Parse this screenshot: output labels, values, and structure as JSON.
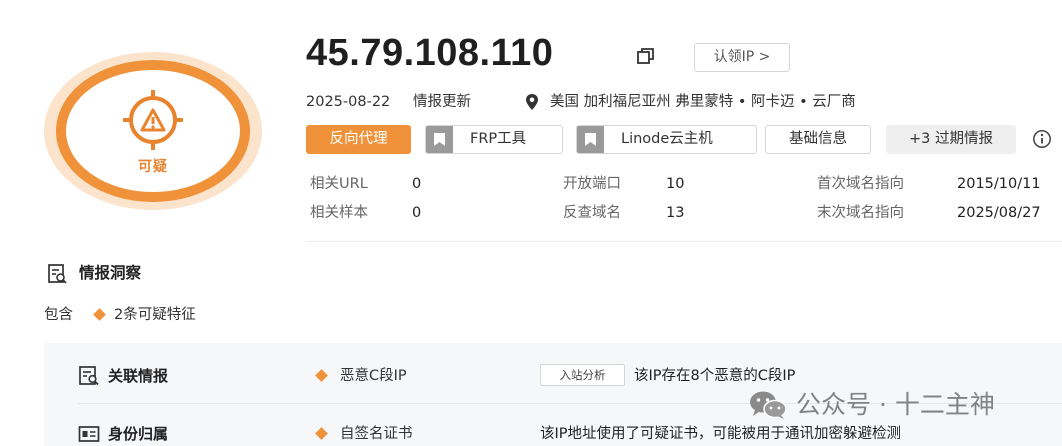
{
  "verdict": {
    "label": "可疑",
    "icon": "bug-warning-icon",
    "color": "#f0923a"
  },
  "header": {
    "ip": "45.79.108.110",
    "claim_button": "认领IP >",
    "update_date": "2025-08-22",
    "update_label": "情报更新",
    "location": "美国 加利福尼亚州 弗里蒙特 • 阿卡迈 • 云厂商"
  },
  "tags": [
    {
      "label": "反向代理"
    },
    {
      "label": "FRP工具"
    },
    {
      "label": "Linode云主机"
    },
    {
      "label": "基础信息"
    },
    {
      "label": "+3 过期情报"
    }
  ],
  "stats": {
    "related_url": {
      "key": "相关URL",
      "value": "0"
    },
    "related_samples": {
      "key": "相关样本",
      "value": "0"
    },
    "open_ports": {
      "key": "开放端口",
      "value": "10"
    },
    "reverse_domains": {
      "key": "反查域名",
      "value": "13"
    },
    "first_domain": {
      "key": "首次域名指向",
      "value": "2015/10/11"
    },
    "last_domain": {
      "key": "末次域名指向",
      "value": "2025/08/27"
    }
  },
  "insight": {
    "title": "情报洞察",
    "contains_label": "包含",
    "count_label": "2条可疑特征"
  },
  "rows": [
    {
      "category": "关联情报",
      "feature": "恶意C段IP",
      "chip": "入站分析",
      "description": "该IP存在8个恶意的C段IP"
    },
    {
      "category": "身份归属",
      "feature": "自签名证书",
      "chip": "",
      "description": "该IP地址使用了可疑证书，可能被用于通讯加密躲避检测"
    }
  ],
  "watermark": {
    "text": "公众号 · 十二主神"
  }
}
